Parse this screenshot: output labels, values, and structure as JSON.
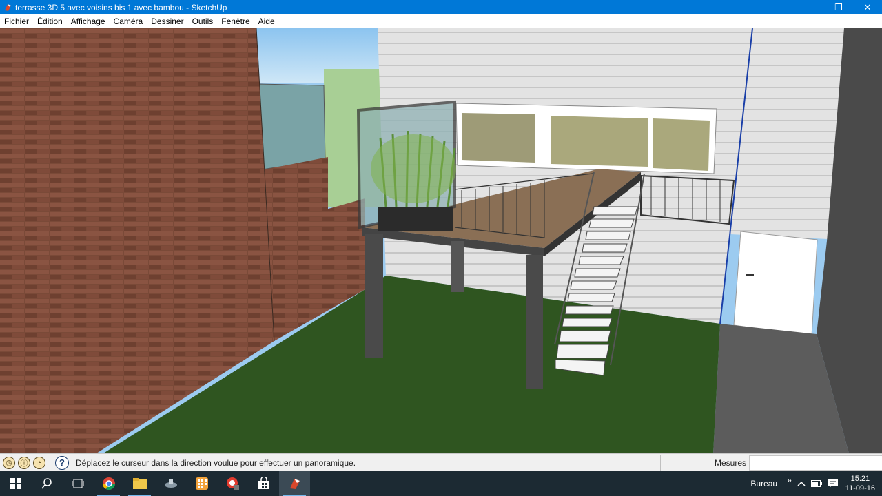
{
  "window": {
    "title": "terrasse 3D 5 avec voisins bis 1 avec bambou - SketchUp",
    "minimize": "—",
    "maximize": "❐",
    "close": "✕"
  },
  "menu": {
    "items": [
      "Fichier",
      "Édition",
      "Affichage",
      "Caméra",
      "Dessiner",
      "Outils",
      "Fenêtre",
      "Aide"
    ]
  },
  "status": {
    "message": "Déplacez le curseur dans la direction voulue pour effectuer un panoramique.",
    "help": "?",
    "measures_label": "Mesures",
    "measures_value": ""
  },
  "taskbar": {
    "bureau_label": "Bureau",
    "bureau_chevron": "»",
    "time": "15:21",
    "date": "11-09-16"
  },
  "colors": {
    "titlebar": "#0078d7",
    "taskbar": "#1c2a33",
    "grass": "#2f5520",
    "brick": "#7a4a38"
  }
}
